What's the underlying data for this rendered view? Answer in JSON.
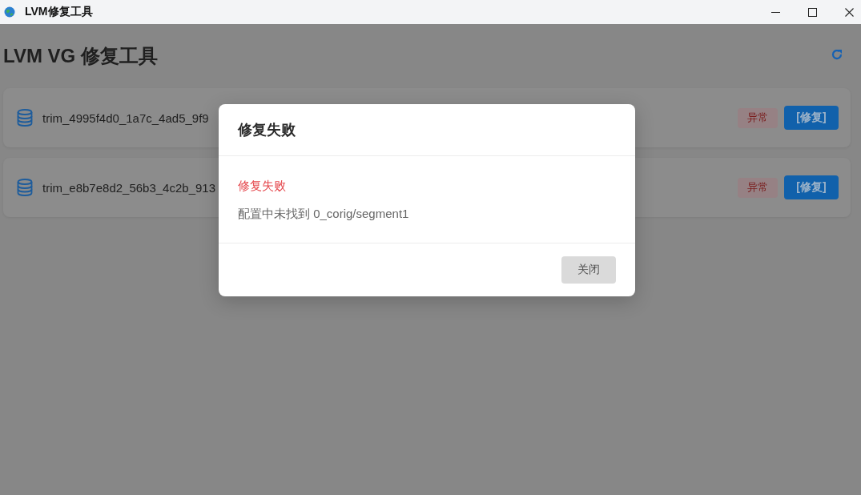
{
  "window": {
    "title": "LVM修复工具"
  },
  "header": {
    "title": "LVM VG 修复工具"
  },
  "volume_groups": [
    {
      "name": "trim_4995f4d0_1a7c_4ad5_9f9",
      "status": {
        "label": "异常",
        "kind": "error"
      },
      "action": "[修复]"
    },
    {
      "name": "trim_e8b7e8d2_56b3_4c2b_913",
      "status": {
        "label": "异常",
        "kind": "error"
      },
      "action": "[修复]"
    }
  ],
  "dialog": {
    "title": "修复失败",
    "error": "修复失败",
    "message": "配置中未找到 0_corig/segment1",
    "buttons": [
      "关闭"
    ]
  }
}
